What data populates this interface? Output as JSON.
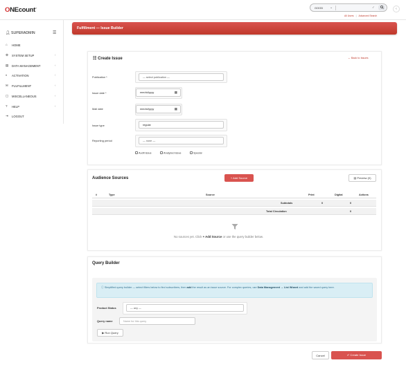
{
  "header": {
    "logo_o": "O",
    "logo_rest": "NEcount",
    "logo_mark": "®",
    "search_select": "GOOD",
    "search_caret": "⌄",
    "clear_icon": "✓",
    "search_button": "🔍",
    "link_all_users": "All Users",
    "link_advanced": "Advanced Search",
    "collapse_icon": "‹"
  },
  "sidebar": {
    "user": "SUPERADMIN",
    "items": [
      {
        "label": "HOME",
        "icon": "home-icon",
        "glyph": "⌂",
        "chevron": ""
      },
      {
        "label": "SYSTEM SETUP",
        "icon": "gear-icon",
        "glyph": "⚙",
        "chevron": "‹"
      },
      {
        "label": "DATA MANAGEMENT",
        "icon": "database-icon",
        "glyph": "▤",
        "chevron": "‹"
      },
      {
        "label": "ACTIVATION",
        "icon": "toggle-icon",
        "glyph": "◐",
        "chevron": "‹"
      },
      {
        "label": "FULFILLMENT",
        "icon": "envelope-icon",
        "glyph": "✉",
        "chevron": "‹"
      },
      {
        "label": "MISCELLANEOUS",
        "icon": "file-icon",
        "glyph": "▢",
        "chevron": "‹"
      },
      {
        "label": "HELP",
        "icon": "question-icon",
        "glyph": "?",
        "chevron": "‹"
      },
      {
        "label": "LOGOUT",
        "icon": "logout-icon",
        "glyph": "⇥",
        "chevron": ""
      }
    ]
  },
  "banner": {
    "title": "Fulfillment — Issue Builder"
  },
  "create_issue": {
    "title": "Create Issue",
    "back_link": "← Back to Issues",
    "publication_label": "Publication *",
    "publication_placeholder": "— select publication —",
    "issue_date_label": "Issue date *",
    "issue_date_value": "mm/dd/yyyy",
    "mail_date_label": "Mail date",
    "mail_date_value": "mm/dd/yyyy",
    "issue_type_label": "Issue type",
    "issue_type_value": "regular",
    "reporting_label": "Reporting period",
    "reporting_value": "— none —",
    "check_audit": "Audit issue",
    "check_analyzed": "Analyzed issue",
    "check_special": "Special"
  },
  "audience": {
    "title": "Audience Sources",
    "add_button": "+ Add Source",
    "preview_button": "▤ Preview (0)",
    "columns": [
      "#",
      "Type",
      "Source",
      "Print",
      "Digital",
      "Actions"
    ],
    "subtotals_label": "Subtotals",
    "subtotals_print": "0",
    "subtotals_digital": "0",
    "total_label": "Total Circulation",
    "total_value": "0",
    "empty_prefix": "No sources yet. Click",
    "empty_bold": "+ Add Source",
    "empty_suffix": "or use the query builder below."
  },
  "query": {
    "title": "Query Builder",
    "info_a": "ⓘ Simplified query builder — select filters below to find subscribers, then",
    "info_b": "add",
    "info_c": "the result as an issue source. For complex queries, use",
    "info_d": "Data Management → List Wizard",
    "info_e": "and add the saved query here.",
    "status_label": "Product Status",
    "status_value": "— any —",
    "name_label": "Query name",
    "name_placeholder": "Name for this query",
    "run_button": "▶ Run Query"
  },
  "footer": {
    "cancel": "Cancel",
    "create": "✔ Create Issue"
  },
  "colors": {
    "brand_red": "#d9534f",
    "info_bg": "#d9eef5"
  }
}
